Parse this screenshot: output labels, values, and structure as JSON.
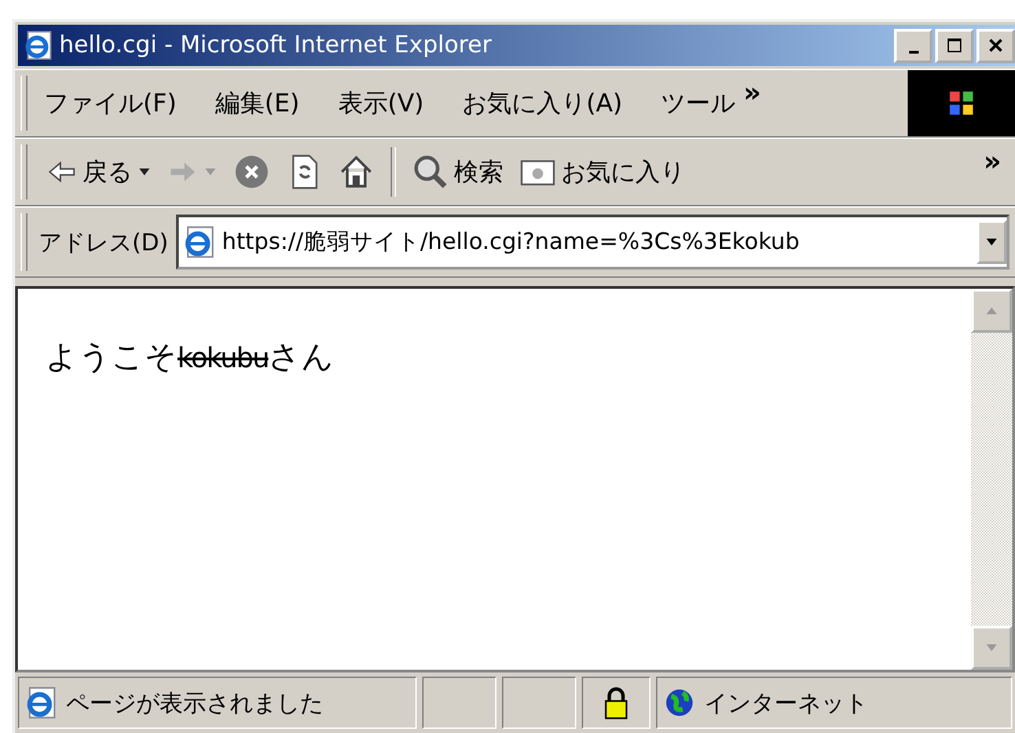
{
  "window": {
    "title": "hello.cgi - Microsoft Internet Explorer"
  },
  "menu": [
    "ファイル(F)",
    "編集(E)",
    "表示(V)",
    "お気に入り(A)",
    "ツール"
  ],
  "menu_more": "»",
  "toolbar": [
    {
      "kind": "back",
      "label": "戻る"
    },
    {
      "kind": "forward"
    },
    {
      "kind": "stop"
    },
    {
      "kind": "refresh"
    },
    {
      "kind": "home"
    },
    {
      "kind": "search",
      "label": "検索"
    },
    {
      "kind": "favorites",
      "label": "お気に入り"
    }
  ],
  "toolbar_more": "»",
  "address": {
    "label": "アドレス(D)",
    "value": "https://脆弱サイト/hello.cgi?name=%3Cs%3Ekokub"
  },
  "content": {
    "parts": [
      {
        "text": "ようこそ",
        "struck": false
      },
      {
        "text": "kokubu",
        "struck": true
      },
      {
        "text": "さん",
        "struck": false
      }
    ]
  },
  "status_bar": {
    "message": "ページが表示されました",
    "secure": true,
    "zone": "インターネット"
  }
}
